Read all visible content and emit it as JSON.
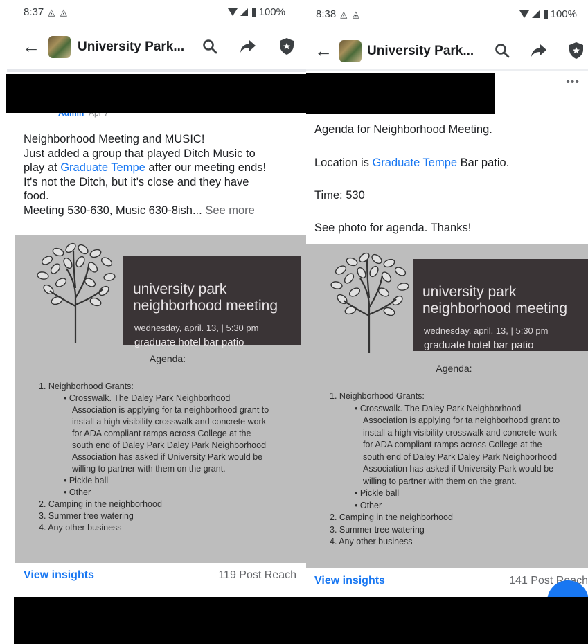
{
  "left": {
    "status": {
      "time": "8:37",
      "battery": "100%"
    },
    "appbar": {
      "title": "University Park..."
    },
    "post": {
      "author": "Admin",
      "date": "Apr 7",
      "line1": "Neighborhood Meeting and MUSIC!",
      "line2a": "Just added a group that played Ditch Music to",
      "line3a": "play at ",
      "line3_link": "Graduate Tempe",
      "line3b": " after our meeting ends!",
      "line4": "It's not the Ditch, but it's close and they have",
      "line5": "food.",
      "line6": "Meeting 530-630, Music 630-8ish...",
      "see_more": " See more"
    },
    "footer": {
      "insights": "View insights",
      "reach": "119 Post Reach"
    }
  },
  "right": {
    "status": {
      "time": "8:38",
      "battery": "100%"
    },
    "appbar": {
      "title": "University Park..."
    },
    "post": {
      "line1": "Agenda for Neighborhood Meeting.",
      "line2a": "Location is ",
      "line2_link": "Graduate Tempe",
      "line2b": " Bar patio.",
      "line3": "Time: 530",
      "line4": "See photo for agenda.  Thanks!"
    },
    "footer": {
      "insights": "View insights",
      "reach": "141 Post Reach"
    }
  },
  "flyer": {
    "title1": "university park",
    "title2": "neighborhood meeting",
    "date": "wednesday, april. 13, | 5:30 pm",
    "venue": "graduate hotel bar patio",
    "agenda_heading": "Agenda:",
    "item1": "1.   Neighborhood Grants:",
    "bullet1_l1": "• Crosswalk. The Daley Park Neighborhood",
    "bullet1_l2": "Association is applying for ta neighborhood grant to",
    "bullet1_l3": "install a high visibility crosswalk and concrete work",
    "bullet1_l4": "for ADA compliant ramps across College at the",
    "bullet1_l5": "south end of Daley Park  Daley Park Neighborhood",
    "bullet1_l6": "Association has asked if University Park would be",
    "bullet1_l7": "willing to partner with them on the grant.",
    "bullet2": "• Pickle ball",
    "bullet3": "• Other",
    "item2": "2. Camping in the neighborhood",
    "item3": "3. Summer tree watering",
    "item4": "4. Any other business"
  },
  "icons": [
    "back-arrow-icon",
    "search-icon",
    "share-icon",
    "shield-icon",
    "more-icon",
    "wifi-icon",
    "signal-icon",
    "battery-icon"
  ],
  "colors": {
    "link": "#1877f2",
    "text": "#1c1e21",
    "muted": "#65676b",
    "banner": "#3a3436",
    "redaction": "#000000"
  }
}
